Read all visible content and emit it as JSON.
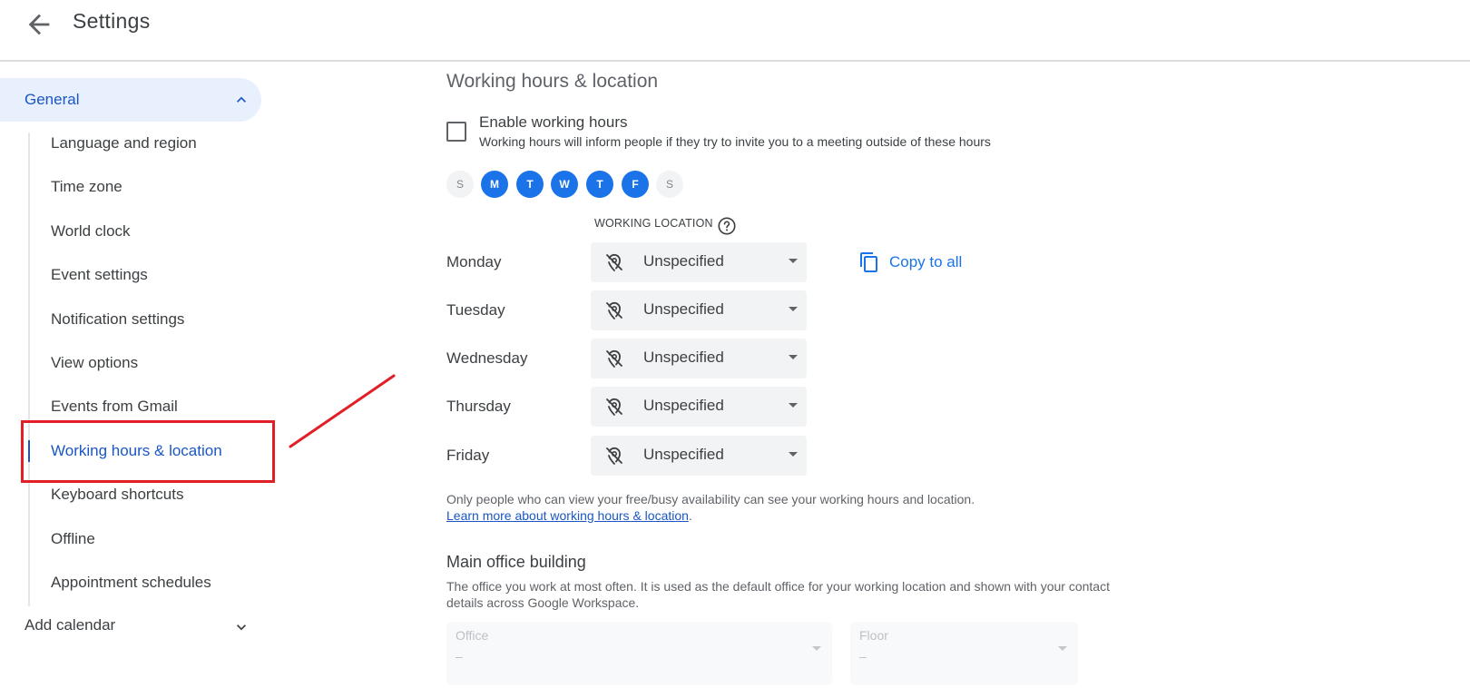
{
  "header": {
    "back_icon": "arrow-back-icon",
    "title": "Settings"
  },
  "sidebar": {
    "general": {
      "label": "General",
      "expanded": true,
      "icon": "chevron-up-icon"
    },
    "items": [
      {
        "label": "Language and region",
        "active": false
      },
      {
        "label": "Time zone",
        "active": false
      },
      {
        "label": "World clock",
        "active": false
      },
      {
        "label": "Event settings",
        "active": false
      },
      {
        "label": "Notification settings",
        "active": false
      },
      {
        "label": "View options",
        "active": false
      },
      {
        "label": "Events from Gmail",
        "active": false
      },
      {
        "label": "Working hours & location",
        "active": true
      },
      {
        "label": "Keyboard shortcuts",
        "active": false
      },
      {
        "label": "Offline",
        "active": false
      },
      {
        "label": "Appointment schedules",
        "active": false
      }
    ],
    "add_calendar": {
      "label": "Add calendar",
      "expanded": false,
      "icon": "chevron-down-icon"
    }
  },
  "annotation": {
    "color": "#e21f26",
    "highlights": "Working hours & location"
  },
  "main": {
    "title": "Working hours & location",
    "enable_working_hours": {
      "checked": false,
      "label": "Enable working hours",
      "description": "Working hours will inform people if they try to invite you to a meeting outside of these hours"
    },
    "days": [
      {
        "letter": "S",
        "name": "Sunday",
        "selected": false
      },
      {
        "letter": "M",
        "name": "Monday",
        "selected": true
      },
      {
        "letter": "T",
        "name": "Tuesday",
        "selected": true
      },
      {
        "letter": "W",
        "name": "Wednesday",
        "selected": true
      },
      {
        "letter": "T",
        "name": "Thursday",
        "selected": true
      },
      {
        "letter": "F",
        "name": "Friday",
        "selected": true
      },
      {
        "letter": "S",
        "name": "Saturday",
        "selected": false
      }
    ],
    "working_location_header": "WORKING LOCATION",
    "help_icon": "help-circle-icon",
    "location_rows": [
      {
        "day": "Monday",
        "value": "Unspecified",
        "icon": "location-off-icon"
      },
      {
        "day": "Tuesday",
        "value": "Unspecified",
        "icon": "location-off-icon"
      },
      {
        "day": "Wednesday",
        "value": "Unspecified",
        "icon": "location-off-icon"
      },
      {
        "day": "Thursday",
        "value": "Unspecified",
        "icon": "location-off-icon"
      },
      {
        "day": "Friday",
        "value": "Unspecified",
        "icon": "location-off-icon"
      }
    ],
    "copy_to_all": {
      "label": "Copy to all",
      "icon": "copy-icon"
    },
    "visibility_note": "Only people who can view your free/busy availability can see your working hours and location.",
    "learn_more_link": "Learn more about working hours & location",
    "learn_more_suffix": ".",
    "main_office": {
      "title": "Main office building",
      "description": "The office you work at most often. It is used as the default office for your working location and shown with your contact details across Google Workspace.",
      "office_field": {
        "label": "Office",
        "value": "–",
        "disabled": true
      },
      "floor_field": {
        "label": "Floor",
        "value": "–",
        "disabled": true
      }
    }
  },
  "colors": {
    "accent": "#1a73e8",
    "active_nav_bg": "#e8f0fe",
    "active_nav_text": "#1a56c4",
    "select_bg": "#f1f3f4"
  }
}
